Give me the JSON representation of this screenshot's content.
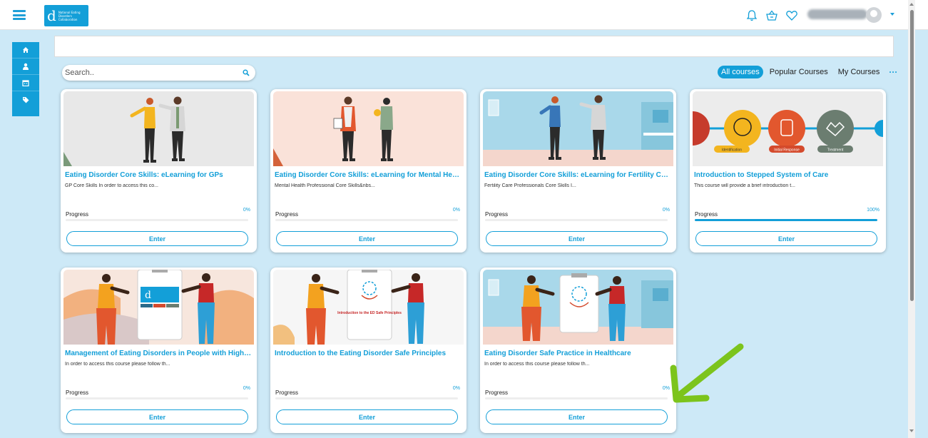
{
  "header": {
    "logo_letter": "d",
    "logo_text": "National Eating Disorders Collaboration",
    "user_name": "Alison Robertson",
    "icons": [
      "bell-icon",
      "basket-icon",
      "heart-icon",
      "user-avatar",
      "chevron-down-icon"
    ]
  },
  "sidebar": {
    "items": [
      {
        "icon": "home-icon",
        "label": "Home"
      },
      {
        "icon": "user-icon",
        "label": "Profile"
      },
      {
        "icon": "calendar-icon",
        "label": "Calendar"
      },
      {
        "icon": "tag-icon",
        "label": "Tags"
      }
    ]
  },
  "search": {
    "placeholder": "Search.."
  },
  "filters": {
    "all": "All courses",
    "popular": "Popular Courses",
    "mine": "My Courses",
    "more": "···"
  },
  "progress_label": "Progress",
  "enter_label": "Enter",
  "courses": [
    {
      "title": "Eating Disorder Core Skills: eLearning for GPs",
      "desc": "GP Core Skills In order to access this co...",
      "progress_text": "0%",
      "progress": 0
    },
    {
      "title": "Eating Disorder Core Skills: eLearning for Mental Health Pro...",
      "desc": "Mental Health Professional Core Skills&nbs...",
      "progress_text": "0%",
      "progress": 0
    },
    {
      "title": "Eating Disorder Core Skills: eLearning for Fertility Care Prof...",
      "desc": "Fertility Care Professionals Core Skills I...",
      "progress_text": "0%",
      "progress": 0
    },
    {
      "title": "Introduction to Stepped System of Care",
      "desc": "This course will provide a brief introduction t...",
      "progress_text": "100%",
      "progress": 100,
      "image_labels": [
        "Identification",
        "Initial Response",
        "Treatment"
      ]
    },
    {
      "title": "Management of Eating Disorders in People with Higher Wei...",
      "desc": "In order to access this course please follow th...",
      "progress_text": "0%",
      "progress": 0
    },
    {
      "title": "Introduction to the Eating Disorder Safe Principles",
      "desc": "",
      "progress_text": "0%",
      "progress": 0,
      "image_text": "Introduction to the ED Safe Principles"
    },
    {
      "title": "Eating Disorder Safe Practice in Healthcare",
      "desc": "In order to access this course please follow th...",
      "progress_text": "0%",
      "progress": 0
    }
  ],
  "colors": {
    "accent": "#139fd8",
    "page_bg": "#cde9f7",
    "arrow": "#7cc41c"
  }
}
